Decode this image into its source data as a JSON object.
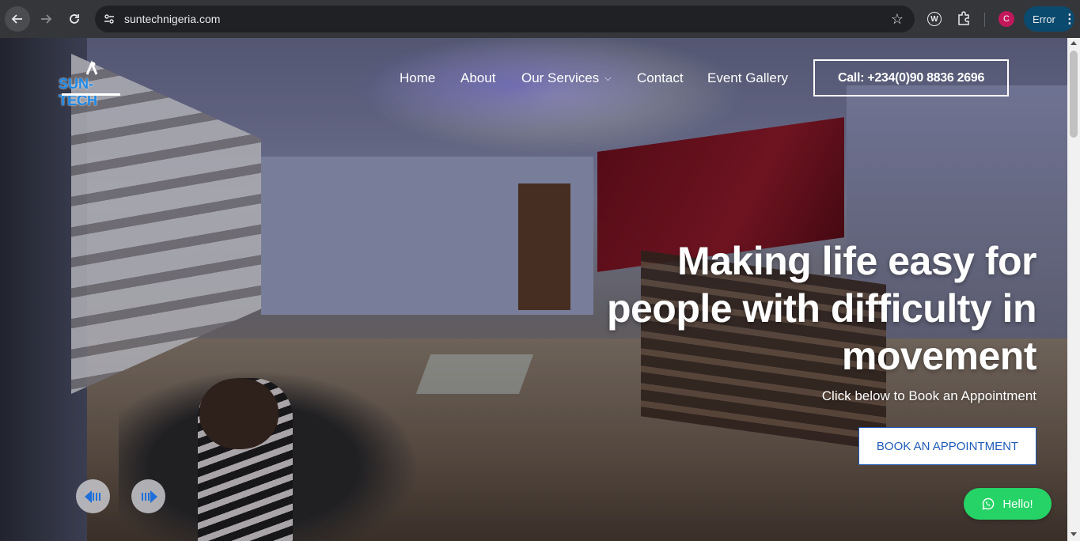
{
  "browser": {
    "url": "suntechnigeria.com",
    "profile_initial": "C",
    "status_label": "Error"
  },
  "site": {
    "logo_text": "SUN-TECH",
    "nav": {
      "home": "Home",
      "about": "About",
      "services": "Our Services",
      "contact": "Contact",
      "gallery": "Event Gallery"
    },
    "call_button": "Call: +234(0)90 8836 2696"
  },
  "hero": {
    "headline_line1": "Making life easy for",
    "headline_line2": "people with difficulty in",
    "headline_line3": "movement",
    "subline": "Click below to Book an Appointment",
    "cta": "BOOK AN APPOINTMENT"
  },
  "whatsapp": {
    "label": "Hello!"
  },
  "colors": {
    "accent": "#1e5bb8",
    "whatsapp": "#25d366",
    "chrome_bg": "#35363a",
    "omnibox_bg": "#202124"
  }
}
